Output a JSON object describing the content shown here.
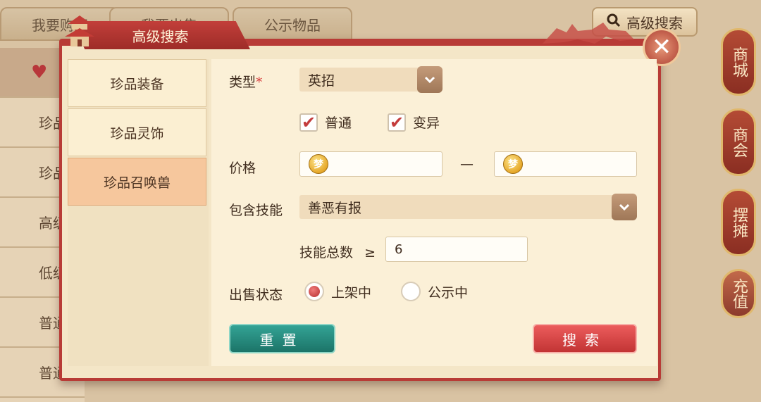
{
  "top_tabs": [
    "我要购买",
    "我要出售",
    "公示物品"
  ],
  "top_search_button": "高级搜索",
  "bg_list": [
    "♥",
    "珍品",
    "珍品",
    "高级",
    "低级",
    "普通",
    "普通"
  ],
  "side_nav": [
    {
      "label": "商城"
    },
    {
      "label": "商会"
    },
    {
      "label": "摆摊"
    },
    {
      "label": "充值"
    }
  ],
  "dialog": {
    "title": "高级搜索",
    "categories": [
      "珍品装备",
      "珍品灵饰",
      "珍品召唤兽"
    ],
    "active_category": 2,
    "form": {
      "type_label": "类型",
      "required_mark": "*",
      "type_value": "英招",
      "checkboxes": [
        {
          "label": "普通",
          "checked": true
        },
        {
          "label": "变异",
          "checked": true
        }
      ],
      "price_label": "价格",
      "price_min": "",
      "price_max": "",
      "price_separator": "—",
      "skill_label": "包含技能",
      "skill_value": "善恶有报",
      "skill_count_label": "技能总数",
      "skill_count_op": "≥",
      "skill_count_value": "6",
      "status_label": "出售状态",
      "status_options": [
        {
          "label": "上架中",
          "selected": true
        },
        {
          "label": "公示中",
          "selected": false
        }
      ]
    },
    "reset_button": "重置",
    "search_button": "搜索"
  },
  "colors": {
    "accent_red": "#b83b36",
    "reset_teal": "#1c7468",
    "search_red": "#c23434",
    "panel_bg": "#fbf0d7"
  }
}
